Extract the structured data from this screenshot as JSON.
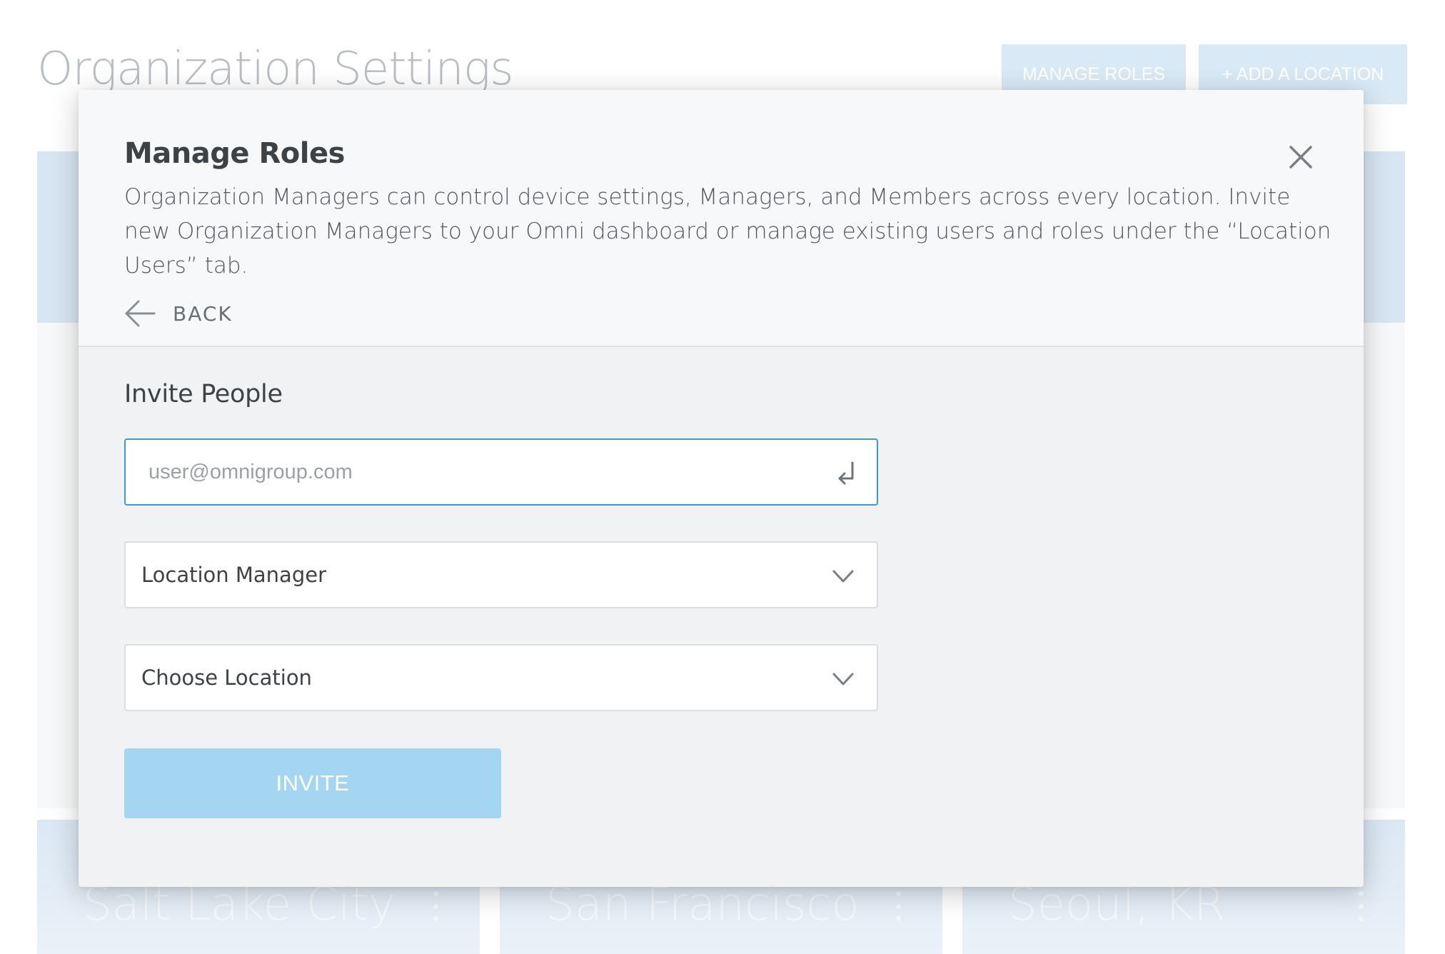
{
  "background": {
    "page_title": "Organization Settings",
    "manage_roles_label": "MANAGE ROLES",
    "add_location_label": "+ ADD A LOCATION",
    "locations": [
      {
        "name": "Salt Lake City"
      },
      {
        "name": "San Francisco"
      },
      {
        "name": "Seoul, KR"
      }
    ]
  },
  "modal": {
    "title": "Manage Roles",
    "description": "Organization Managers can control device settings, Managers, and Members across every location. Invite new Organization Managers to your Omni dashboard or manage existing users and roles under the “Location Users” tab.",
    "back_label": "BACK",
    "close_icon": "close-icon",
    "invite": {
      "section_title": "Invite People",
      "email": {
        "value": "",
        "placeholder": "user@omnigroup.com",
        "icon": "enter-return-icon"
      },
      "role_select": {
        "selected": "Location Manager"
      },
      "location_select": {
        "selected": "Choose Location"
      },
      "invite_button_label": "INVITE"
    }
  },
  "colors": {
    "accent_blue": "#3a9ad9",
    "invite_button": "#a4d6f1",
    "modal_background": "#f1f2f4"
  }
}
